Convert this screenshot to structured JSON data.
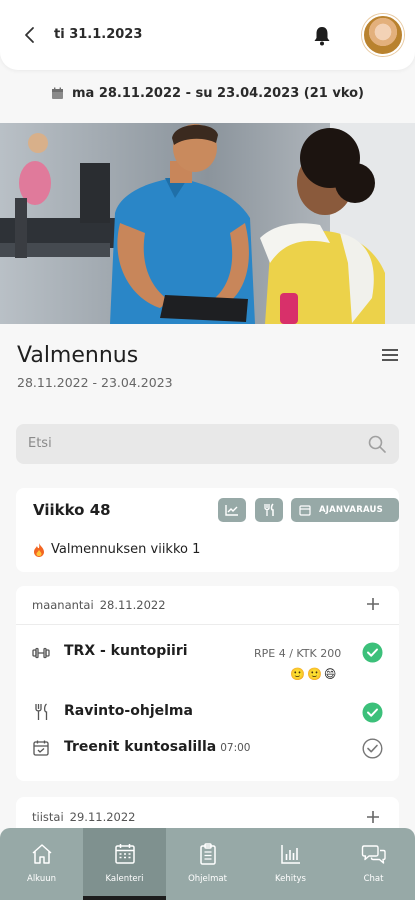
{
  "header": {
    "date": "ti 31.1.2023",
    "back_icon": "chevron-left-icon",
    "bell_icon": "bell-icon"
  },
  "period": {
    "text": "ma 28.11.2022 - su 23.04.2023 (21 vko)"
  },
  "program": {
    "title": "Valmennus",
    "dates": "28.11.2022 - 23.04.2023"
  },
  "search": {
    "placeholder": "Etsi"
  },
  "week": {
    "title": "Viikko 48",
    "booking_label": "AJANVARAUS",
    "note": "Valmennuksen viikko 1"
  },
  "days": [
    {
      "weekday": "maanantai",
      "date": "28.11.2022",
      "items": [
        {
          "label": "TRX - kuntopiiri",
          "meta": "RPE 4 / KTK 200",
          "emojis": "🙂🙂😄",
          "done": true
        },
        {
          "label": "Ravinto-ohjelma",
          "done": true
        },
        {
          "label": "Treenit kuntosalilla",
          "time": "07:00",
          "done": false
        }
      ]
    },
    {
      "weekday": "tiistai",
      "date": "29.11.2022"
    }
  ],
  "tabs": [
    {
      "label": "Alkuun",
      "icon": "home-icon"
    },
    {
      "label": "Kalenteri",
      "icon": "calendar-icon"
    },
    {
      "label": "Ohjelmat",
      "icon": "clipboard-icon"
    },
    {
      "label": "Kehitys",
      "icon": "chart-icon"
    },
    {
      "label": "Chat",
      "icon": "chat-icon"
    }
  ],
  "colors": {
    "accent": "#97a9a7",
    "accent_dark": "#7f918f",
    "check_green": "#3cc07a"
  }
}
